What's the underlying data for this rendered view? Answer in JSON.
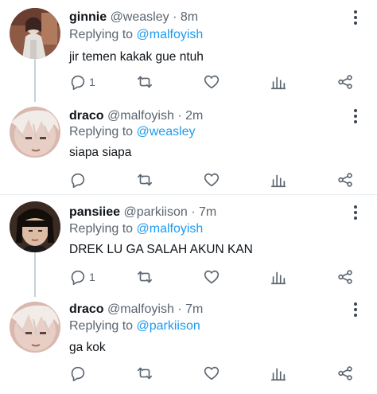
{
  "tweets": [
    {
      "name": "ginnie",
      "handle": "@weasley",
      "separator": "·",
      "time": "8m",
      "reply_prefix": "Replying to",
      "reply_to": "@malfoyish",
      "text": "jir temen kakak gue ntuh",
      "reply_count": "1",
      "avatar_colors": [
        "#7a4a3a",
        "#d8d4cf",
        "#3b2a24"
      ]
    },
    {
      "name": "draco",
      "handle": "@malfoyish",
      "separator": "·",
      "time": "2m",
      "reply_prefix": "Replying to",
      "reply_to": "@weasley",
      "text": "siapa siapa",
      "reply_count": "",
      "avatar_colors": [
        "#c9a49a",
        "#efe3dd",
        "#8a6a64"
      ]
    },
    {
      "name": "pansiiee",
      "handle": "@parkiison",
      "separator": "·",
      "time": "7m",
      "reply_prefix": "Replying to",
      "reply_to": "@malfoyish",
      "text": "DREK LU GA SALAH AKUN KAN",
      "reply_count": "1",
      "avatar_colors": [
        "#1c1410",
        "#d9b9a2",
        "#5a3d30"
      ]
    },
    {
      "name": "draco",
      "handle": "@malfoyish",
      "separator": "·",
      "time": "7m",
      "reply_prefix": "Replying to",
      "reply_to": "@parkiison",
      "text": "ga kok",
      "reply_count": "",
      "avatar_colors": [
        "#c9a49a",
        "#efe3dd",
        "#8a6a64"
      ]
    }
  ],
  "icons": {
    "more": "more-vertical-icon",
    "reply": "comment-icon",
    "retweet": "retweet-icon",
    "like": "heart-icon",
    "stats": "analytics-icon",
    "share": "share-icon"
  },
  "colors": {
    "link": "#1d9bf0",
    "muted": "#5b6570",
    "text": "#0f1419",
    "thread_line": "#c9d1d8"
  }
}
